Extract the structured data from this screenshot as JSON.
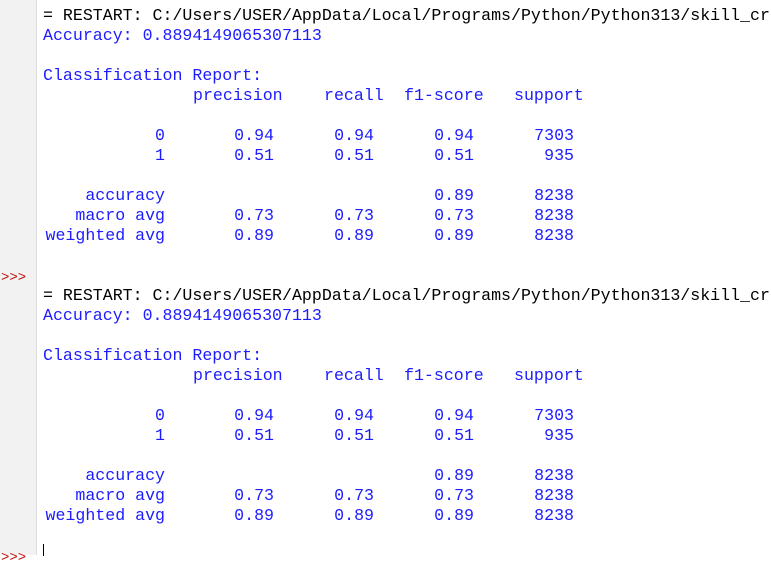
{
  "prompt_symbol": ">>>",
  "runs": [
    {
      "restart": "= RESTART: C:/Users/USER/AppData/Local/Programs/Python/Python313/skill_cr",
      "accuracy_line": "Accuracy: 0.8894149065307113",
      "report_title": "Classification Report:",
      "headers": [
        "precision",
        "recall",
        "f1-score",
        "support"
      ],
      "rows": [
        {
          "label": "0",
          "precision": "0.94",
          "recall": "0.94",
          "f1": "0.94",
          "support": "7303"
        },
        {
          "label": "1",
          "precision": "0.51",
          "recall": "0.51",
          "f1": "0.51",
          "support": "935"
        }
      ],
      "summary": [
        {
          "label": "accuracy",
          "precision": "",
          "recall": "",
          "f1": "0.89",
          "support": "8238"
        },
        {
          "label": "macro avg",
          "precision": "0.73",
          "recall": "0.73",
          "f1": "0.73",
          "support": "8238"
        },
        {
          "label": "weighted avg",
          "precision": "0.89",
          "recall": "0.89",
          "f1": "0.89",
          "support": "8238"
        }
      ]
    },
    {
      "restart": "= RESTART: C:/Users/USER/AppData/Local/Programs/Python/Python313/skill_cr",
      "accuracy_line": "Accuracy: 0.8894149065307113",
      "report_title": "Classification Report:",
      "headers": [
        "precision",
        "recall",
        "f1-score",
        "support"
      ],
      "rows": [
        {
          "label": "0",
          "precision": "0.94",
          "recall": "0.94",
          "f1": "0.94",
          "support": "7303"
        },
        {
          "label": "1",
          "precision": "0.51",
          "recall": "0.51",
          "f1": "0.51",
          "support": "935"
        }
      ],
      "summary": [
        {
          "label": "accuracy",
          "precision": "",
          "recall": "",
          "f1": "0.89",
          "support": "8238"
        },
        {
          "label": "macro avg",
          "precision": "0.73",
          "recall": "0.73",
          "f1": "0.73",
          "support": "8238"
        },
        {
          "label": "weighted avg",
          "precision": "0.89",
          "recall": "0.89",
          "f1": "0.89",
          "support": "8238"
        }
      ]
    }
  ]
}
